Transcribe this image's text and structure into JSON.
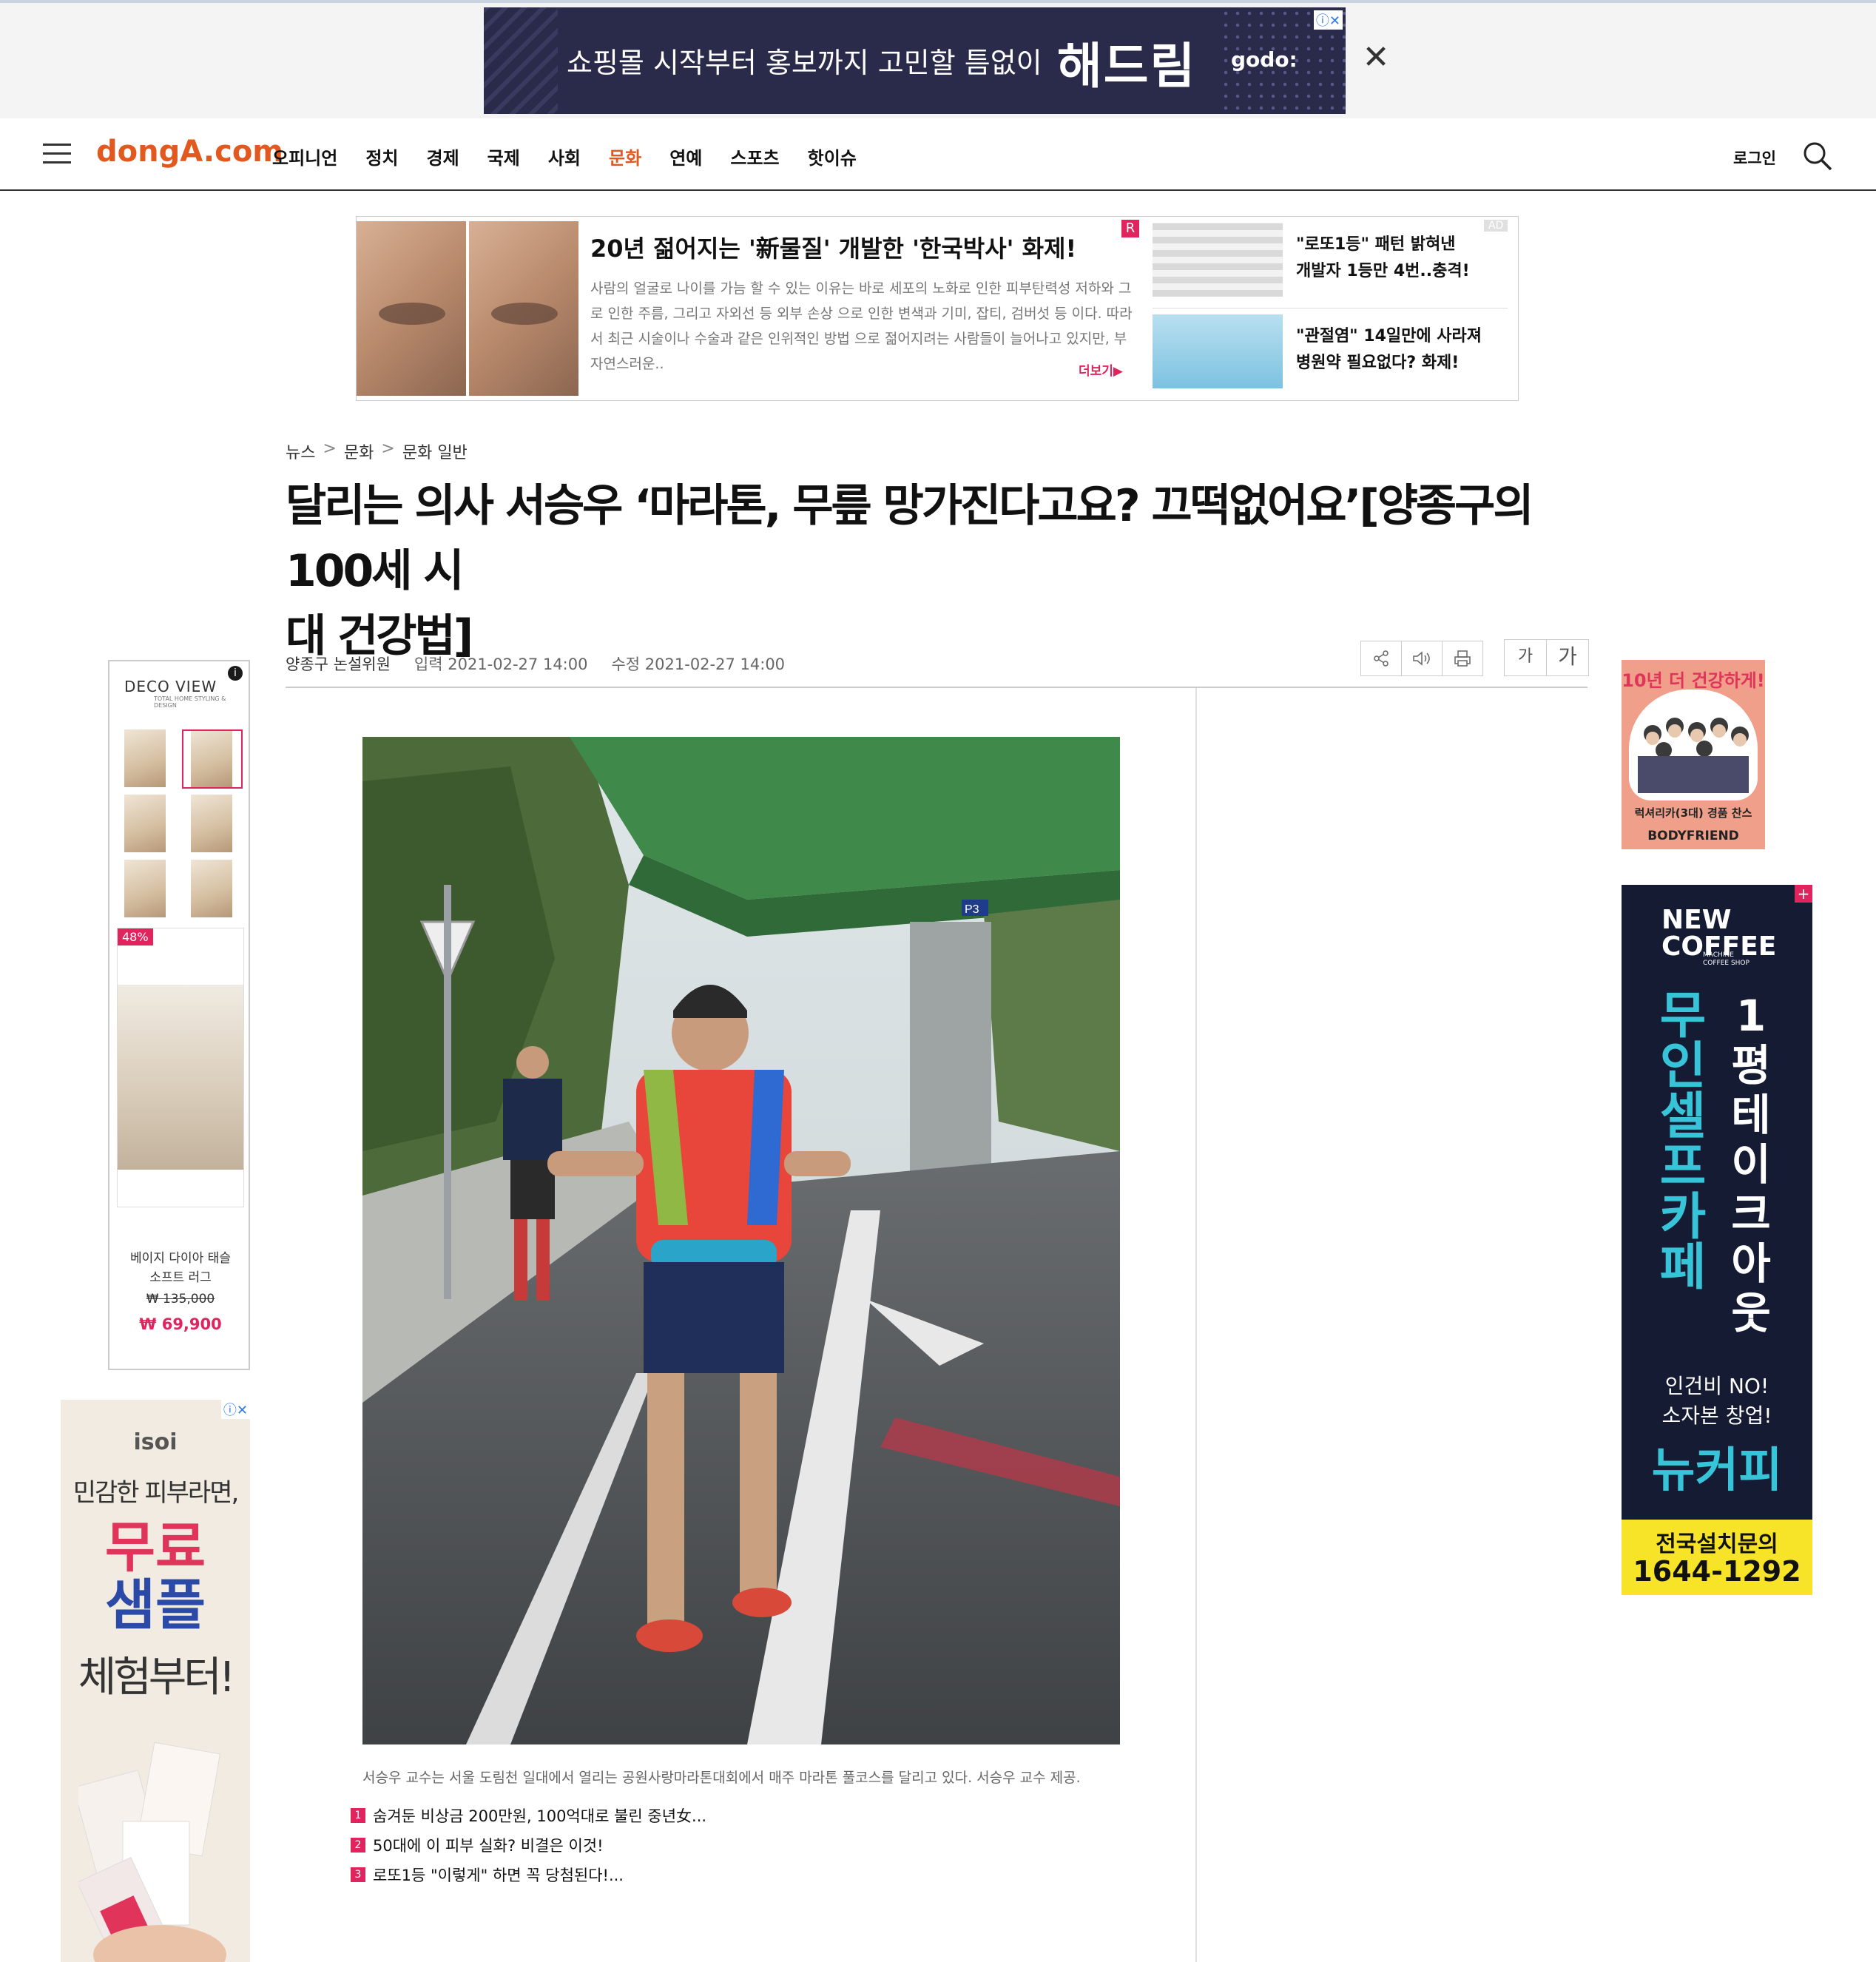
{
  "top_ad": {
    "headline": "쇼핑몰 시작부터 홍보까지 고민할 틈없이",
    "brand": "해드림",
    "logo": "godo:",
    "close_icon": "close-icon"
  },
  "nav": {
    "logo": "dongA.com",
    "items": [
      "오피니언",
      "정치",
      "경제",
      "국제",
      "사회",
      "문화",
      "연예",
      "스포츠",
      "핫이슈"
    ],
    "active_item": "문화",
    "login": "로그인",
    "accent_color": "#e2591f"
  },
  "native_ad": {
    "title": "20년 젊어지는 '新물질' 개발한 '한국박사' 화제!",
    "body": "사람의 얼굴로 나이를 가늠 할 수 있는 이유는 바로 세포의 노화로 인한 피부탄력성 저하와 그로 인한 주름, 그리고 자외선 등 외부 손상 으로 인한 변색과 기미, 잡티, 검버섯 등 이다. 따라서 최근 시술이나 수술과 같은 인위적인 방법 으로 젊어지려는 사람들이 늘어나고 있지만, 부자연스러운..",
    "more": "더보기▶",
    "badge": "R",
    "ad_tag": "AD",
    "side_items": [
      {
        "text_line1": "\"로또1등\" 패턴 밝혀낸",
        "text_line2": "개발자 1등만 4번..충격!"
      },
      {
        "text_line1": "\"관절염\" 14일만에 사라져",
        "text_line2": "병원약 필요없다? 화제!"
      }
    ]
  },
  "article": {
    "breadcrumb": [
      "뉴스",
      "문화",
      "문화 일반"
    ],
    "breadcrumb_sep": ">",
    "headline_line1": "달리는 의사 서승우 ‘마라톤, 무릎 망가진다고요? 끄떡없어요’[양종구의 100세 시",
    "headline_line2": "대 건강법]",
    "author": "양종구 논설위원",
    "input_date": "입력 2021-02-27 14:00",
    "edit_date": "수정 2021-02-27 14:00",
    "font_small": "가",
    "font_large": "가",
    "caption": "서승우 교수는 서울 도림천 일대에서 열리는 공원사랑마라톤대회에서 매주 마라톤 풀코스를 달리고 있다. 서승우 교수 제공.",
    "photo_sign": "P3"
  },
  "related": [
    {
      "num": "1",
      "text": "숨겨둔 비상금 200만원, 100억대로 불린 중년女..."
    },
    {
      "num": "2",
      "text": "50대에 이 피부 실화? 비결은 이것!"
    },
    {
      "num": "3",
      "text": "로또1등 \"이렇게\" 하면 꼭 당첨된다!..."
    }
  ],
  "deco_ad": {
    "logo": "DECO VIEW",
    "sub": "TOTAL HOME STYLING & DESIGN",
    "badge": "48%",
    "product_line1": "베이지 다이아 태슬",
    "product_line2": "소프트 러그",
    "old_price": "₩ 135,000",
    "price": "₩ 69,900"
  },
  "isoi_ad": {
    "brand": "isoi",
    "line1": "민감한 피부라면,",
    "line2": "무료",
    "line3": "샘플",
    "line4": "체험부터!"
  },
  "bodyfriend_ad": {
    "title": "10년 더 건강하게!",
    "line2": "럭셔리카(3대) 경품 찬스",
    "brand": "BODYFRIEND"
  },
  "coffee_ad": {
    "logo_line1": "NEW",
    "logo_line2": "COFFEE",
    "sub": "MACHINE COFFEE SHOP",
    "vertical1": [
      "무",
      "인",
      "셀",
      "프",
      "카",
      "페"
    ],
    "vertical2": [
      "1",
      "평",
      "테",
      "이",
      "크",
      "아",
      "웃"
    ],
    "line1": "인건비 NO!",
    "line2": "소자본 창업!",
    "brand": "뉴커피",
    "footer1": "전국설치문의",
    "footer2": "1644-1292"
  }
}
